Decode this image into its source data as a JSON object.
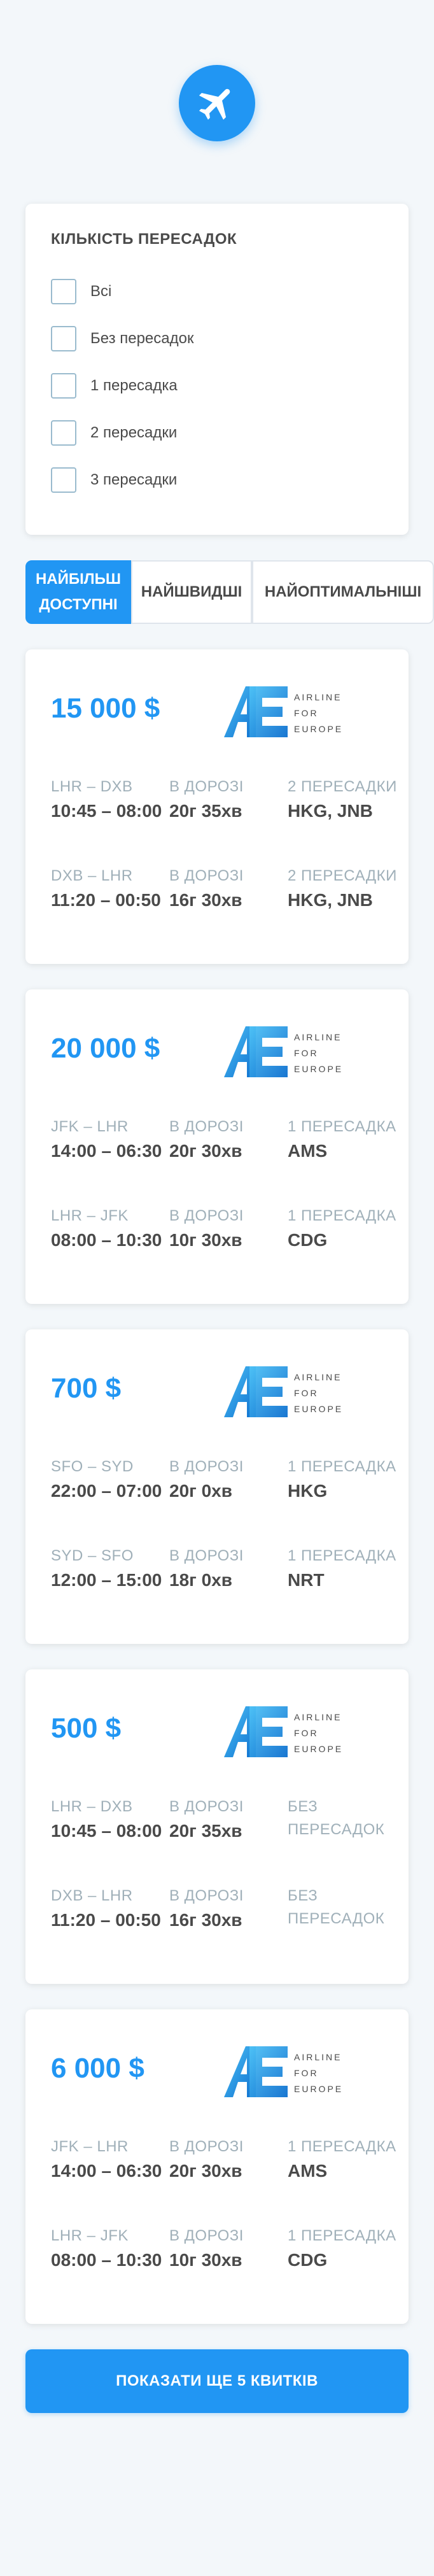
{
  "app": {
    "logo_icon": "airplane-icon",
    "accent": "#2196f3"
  },
  "filter": {
    "title": "Кількість пересадок",
    "options": [
      {
        "label": "Всі",
        "checked": false
      },
      {
        "label": "Без пересадок",
        "checked": false
      },
      {
        "label": "1 пересадка",
        "checked": false
      },
      {
        "label": "2 пересадки",
        "checked": false
      },
      {
        "label": "3 пересадки",
        "checked": false
      }
    ]
  },
  "tabs": [
    {
      "label": "Найбільш доступні",
      "active": true
    },
    {
      "label": "Найшвидші",
      "active": false
    },
    {
      "label": "Найоптимальніші",
      "active": false
    }
  ],
  "airline": {
    "word1": "AIRLINE",
    "word2": "FOR",
    "word3": "EUROPE",
    "mark": "AE"
  },
  "tickets": [
    {
      "price": "15 000 $",
      "segments": [
        {
          "route": "LHR – DXB",
          "times": "10:45 – 08:00",
          "duration_label": "В дорозі",
          "duration": "20г 35хв",
          "stops_label": "2 пересадки",
          "stops": "HKG, JNB"
        },
        {
          "route": "DXB – LHR",
          "times": "11:20 – 00:50",
          "duration_label": "В дорозі",
          "duration": "16г 30хв",
          "stops_label": "2 пересадки",
          "stops": "HKG, JNB"
        }
      ]
    },
    {
      "price": "20 000 $",
      "segments": [
        {
          "route": "JFK – LHR",
          "times": "14:00 – 06:30",
          "duration_label": "В дорозі",
          "duration": "20г 30хв",
          "stops_label": "1 пересадка",
          "stops": "AMS"
        },
        {
          "route": "LHR – JFK",
          "times": "08:00 – 10:30",
          "duration_label": "В дорозі",
          "duration": "10г 30хв",
          "stops_label": "1 пересадка",
          "stops": "CDG"
        }
      ]
    },
    {
      "price": "700 $",
      "segments": [
        {
          "route": "SFO – SYD",
          "times": "22:00 – 07:00",
          "duration_label": "В дорозі",
          "duration": "20г 0хв",
          "stops_label": "1 пересадка",
          "stops": "HKG"
        },
        {
          "route": "SYD – SFO",
          "times": "12:00 – 15:00",
          "duration_label": "В дорозі",
          "duration": "18г 0хв",
          "stops_label": "1 пересадка",
          "stops": "NRT"
        }
      ]
    },
    {
      "price": "500 $",
      "segments": [
        {
          "route": "LHR – DXB",
          "times": "10:45 – 08:00",
          "duration_label": "В дорозі",
          "duration": "20г 35хв",
          "stops_label": "Без пересадок",
          "stops": ""
        },
        {
          "route": "DXB – LHR",
          "times": "11:20 – 00:50",
          "duration_label": "В дорозі",
          "duration": "16г 30хв",
          "stops_label": "Без пересадок",
          "stops": ""
        }
      ]
    },
    {
      "price": "6 000 $",
      "segments": [
        {
          "route": "JFK – LHR",
          "times": "14:00 – 06:30",
          "duration_label": "В дорозі",
          "duration": "20г 30хв",
          "stops_label": "1 пересадка",
          "stops": "AMS"
        },
        {
          "route": "LHR – JFK",
          "times": "08:00 – 10:30",
          "duration_label": "В дорозі",
          "duration": "10г 30хв",
          "stops_label": "1 пересадка",
          "stops": "CDG"
        }
      ]
    }
  ],
  "more_button": "Показати ще 5 квитків"
}
